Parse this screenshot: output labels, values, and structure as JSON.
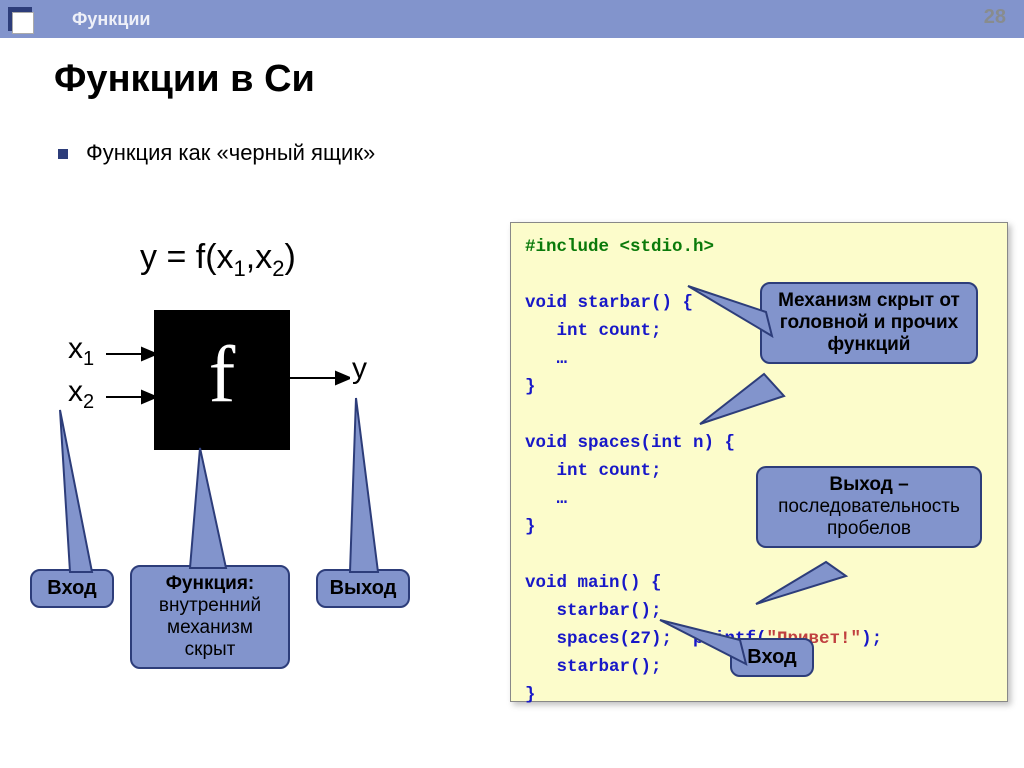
{
  "header": {
    "section": "Функции",
    "page": "28"
  },
  "title": "Функции в Си",
  "bullet": "Функция как «черный ящик»",
  "formula": {
    "lhs": "y = f(x",
    "s1": "1",
    "mid": ",x",
    "s2": "2",
    "rhs": ")"
  },
  "labels": {
    "x1a": "x",
    "x1b": "1",
    "x2a": "x",
    "x2b": "2",
    "y": "y",
    "f": "f"
  },
  "callouts": {
    "input": "Вход",
    "func_b": "Функция:",
    "func_rest": "внутренний механизм скрыт",
    "output": "Выход",
    "mech": "Механизм скрыт от головной и прочих функций",
    "seq_b": "Выход –",
    "seq_rest": "последовательность пробелов",
    "input2": "Вход"
  },
  "code": {
    "include": "#include <stdio.h>",
    "l1": "void starbar() {",
    "l2": "   int count;",
    "l3": "   …",
    "l4": "}",
    "l5": "void spaces(int n) {",
    "l6": "   int count;",
    "l7": "   …",
    "l8": "}",
    "l9": "void main() {",
    "l10": "   starbar();",
    "l11a": "   spaces(27);  printf(",
    "l11s": "\"Привет!\"",
    "l11b": ");",
    "l12": "   starbar();",
    "l13": "}"
  }
}
